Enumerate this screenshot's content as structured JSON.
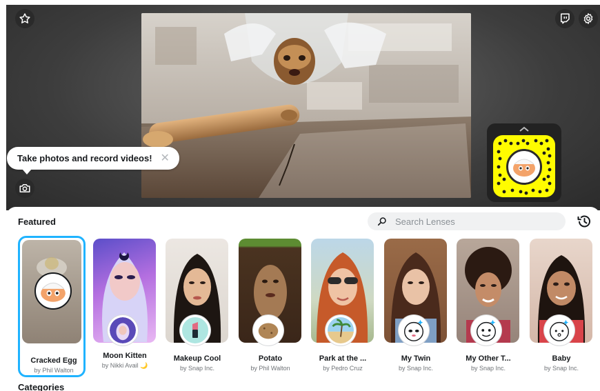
{
  "tooltip": {
    "text": "Take photos and record videos!",
    "close": "✕"
  },
  "panel": {
    "featured_title": "Featured",
    "categories_title": "Categories",
    "search": {
      "placeholder": "Search Lenses",
      "value": ""
    }
  },
  "colors": {
    "accent_selected": "#1fb3ff",
    "snapcode_yellow": "#fffc00",
    "twitch_purple": "#9146ff"
  },
  "icons": {
    "favorite": "star-icon",
    "twitch": "twitch-icon",
    "settings": "gear-icon",
    "camera": "camera-icon",
    "search": "search-icon",
    "history": "history-icon",
    "expand": "chevron-up-icon"
  },
  "lenses": [
    {
      "name": "Cracked Egg",
      "author": "by Phil Walton",
      "selected": true
    },
    {
      "name": "Moon Kitten",
      "author": "by Nikki Avail 🌙",
      "selected": false
    },
    {
      "name": "Makeup Cool",
      "author": "by Snap Inc.",
      "selected": false
    },
    {
      "name": "Potato",
      "author": "by Phil Walton",
      "selected": false
    },
    {
      "name": "Park at the ...",
      "author": "by Pedro Cruz",
      "selected": false
    },
    {
      "name": "My Twin",
      "author": "by Snap Inc.",
      "selected": false
    },
    {
      "name": "My Other T...",
      "author": "by Snap Inc.",
      "selected": false
    },
    {
      "name": "Baby",
      "author": "by Snap Inc.",
      "selected": false
    }
  ]
}
